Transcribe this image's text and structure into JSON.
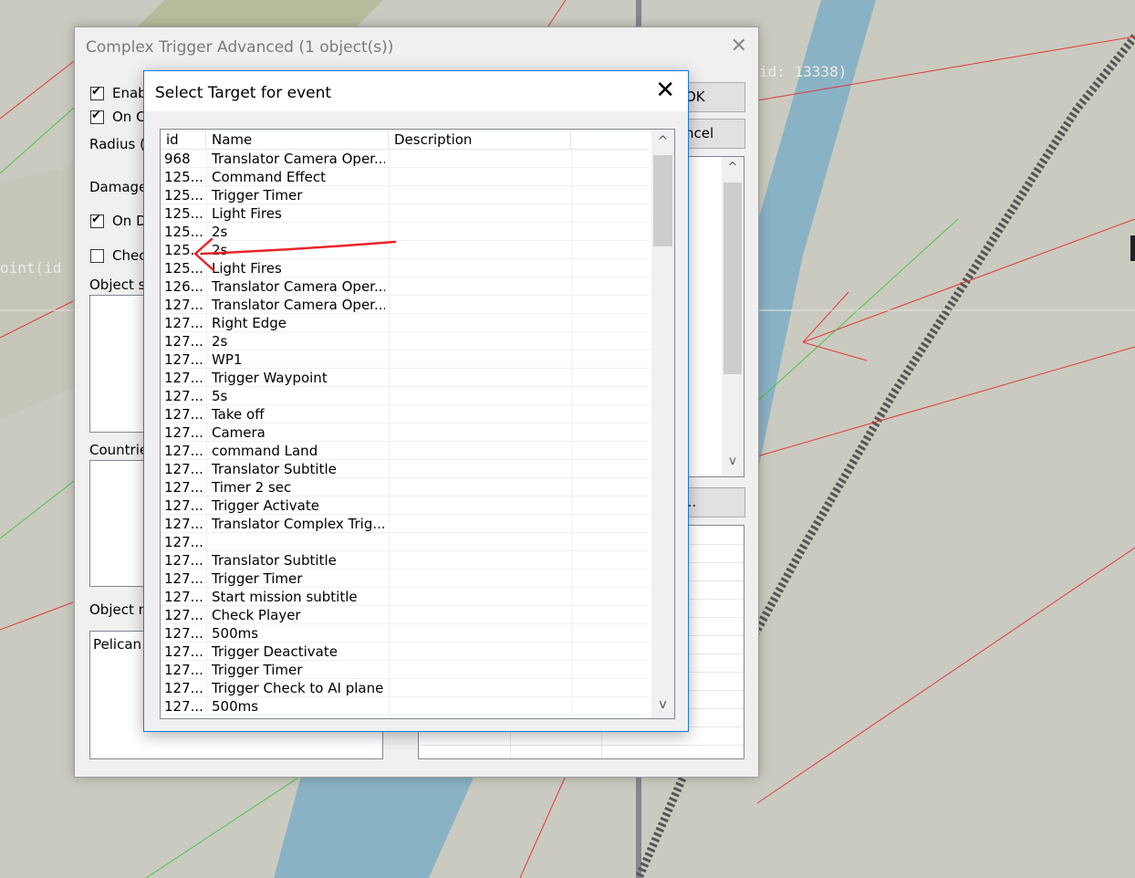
{
  "background": {
    "label_top_right": "id: 13338)",
    "label_left": "oint(id"
  },
  "outer_dialog": {
    "title": "Complex Trigger Advanced (1 object(s))",
    "close_glyph": "✕",
    "enable_label": "Enab",
    "on_label": "On C",
    "radius_label": "Radius (",
    "damage_label": "Damage",
    "on_d_label": "On D",
    "check_label": "Chec",
    "object_s_label": "Object s",
    "countries_label": "Countrie",
    "object_n_label": "Object n",
    "object_name_value": "Pelican",
    "ok_label": "OK",
    "cancel_label": "ncel",
    "edit_label": "t...",
    "scroll_up": "^",
    "scroll_down": "v"
  },
  "inner_dialog": {
    "title": "Select Target for event",
    "close_glyph": "✕",
    "columns": [
      "id",
      "Name",
      "Description"
    ],
    "scroll_up": "^",
    "scroll_down": "v",
    "rows": [
      {
        "id": "968",
        "name": "Translator Camera Oper...",
        "desc": ""
      },
      {
        "id": "125...",
        "name": "Command Effect",
        "desc": ""
      },
      {
        "id": "125...",
        "name": "Trigger Timer",
        "desc": ""
      },
      {
        "id": "125...",
        "name": "Light Fires",
        "desc": ""
      },
      {
        "id": "125...",
        "name": "2s",
        "desc": ""
      },
      {
        "id": "125...",
        "name": "2s",
        "desc": ""
      },
      {
        "id": "125...",
        "name": "Light Fires",
        "desc": ""
      },
      {
        "id": "126...",
        "name": "Translator Camera Oper...",
        "desc": ""
      },
      {
        "id": "127...",
        "name": "Translator Camera Oper...",
        "desc": ""
      },
      {
        "id": "127...",
        "name": "Right Edge",
        "desc": ""
      },
      {
        "id": "127...",
        "name": "2s",
        "desc": ""
      },
      {
        "id": "127...",
        "name": "WP1",
        "desc": ""
      },
      {
        "id": "127...",
        "name": "Trigger Waypoint",
        "desc": ""
      },
      {
        "id": "127...",
        "name": "5s",
        "desc": ""
      },
      {
        "id": "127...",
        "name": "Take off",
        "desc": ""
      },
      {
        "id": "127...",
        "name": "Camera",
        "desc": ""
      },
      {
        "id": "127...",
        "name": "command Land",
        "desc": ""
      },
      {
        "id": "127...",
        "name": "Translator Subtitle",
        "desc": ""
      },
      {
        "id": "127...",
        "name": "Timer 2 sec",
        "desc": ""
      },
      {
        "id": "127...",
        "name": "Trigger Activate",
        "desc": ""
      },
      {
        "id": "127...",
        "name": "Translator Complex Trig...",
        "desc": ""
      },
      {
        "id": "127...",
        "name": "",
        "desc": ""
      },
      {
        "id": "127...",
        "name": "Translator Subtitle",
        "desc": ""
      },
      {
        "id": "127...",
        "name": "Trigger Timer",
        "desc": ""
      },
      {
        "id": "127...",
        "name": "Start mission subtitle",
        "desc": ""
      },
      {
        "id": "127...",
        "name": "Check Player",
        "desc": ""
      },
      {
        "id": "127...",
        "name": "500ms",
        "desc": ""
      },
      {
        "id": "127...",
        "name": "Trigger Deactivate",
        "desc": ""
      },
      {
        "id": "127...",
        "name": "Trigger Timer",
        "desc": ""
      },
      {
        "id": "127...",
        "name": "Trigger Check to AI plane",
        "desc": ""
      },
      {
        "id": "127...",
        "name": "500ms",
        "desc": ""
      }
    ]
  },
  "annotation": {
    "color": "#e8242a"
  }
}
